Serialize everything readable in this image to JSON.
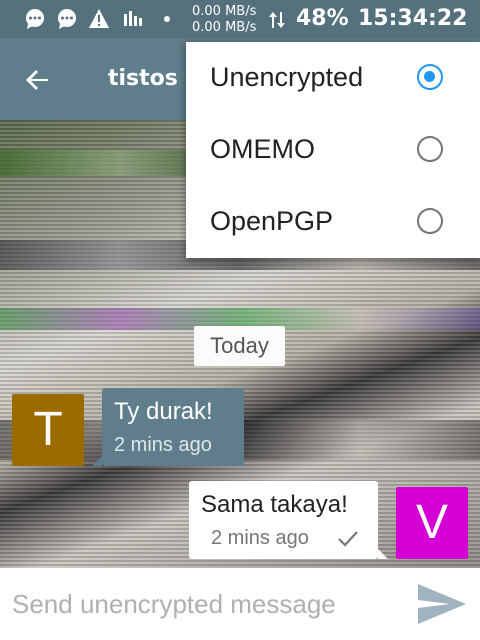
{
  "status_bar": {
    "icons": [
      "chat-bubble-icon",
      "chat-bubble-icon",
      "warning-icon",
      "signal-bars-icon",
      "dot-icon"
    ],
    "net_up": "0.00 MB/s",
    "net_down": "0.00 MB/s",
    "battery": "48%",
    "time": "15:34:22"
  },
  "app_bar": {
    "back_icon": "arrow-left-icon",
    "title": "tistos"
  },
  "encryption_menu": {
    "options": [
      {
        "label": "Unencrypted",
        "selected": true
      },
      {
        "label": "OMEMO",
        "selected": false
      },
      {
        "label": "OpenPGP",
        "selected": false
      }
    ]
  },
  "chat": {
    "date_separator": "Today",
    "messages": [
      {
        "direction": "incoming",
        "avatar_letter": "T",
        "avatar_color": "#9c6b00",
        "text": "Ty durak!",
        "time": "2 mins ago"
      },
      {
        "direction": "outgoing",
        "avatar_letter": "V",
        "avatar_color": "#d400d4",
        "text": "Sama takaya!",
        "time": "2 mins ago",
        "status_icon": "check-icon"
      }
    ]
  },
  "composer": {
    "placeholder": "Send unencrypted message",
    "value": "",
    "send_icon": "send-icon"
  },
  "colors": {
    "primary": "#607d8b",
    "status_bar": "#56717e",
    "accent": "#2196f3"
  }
}
